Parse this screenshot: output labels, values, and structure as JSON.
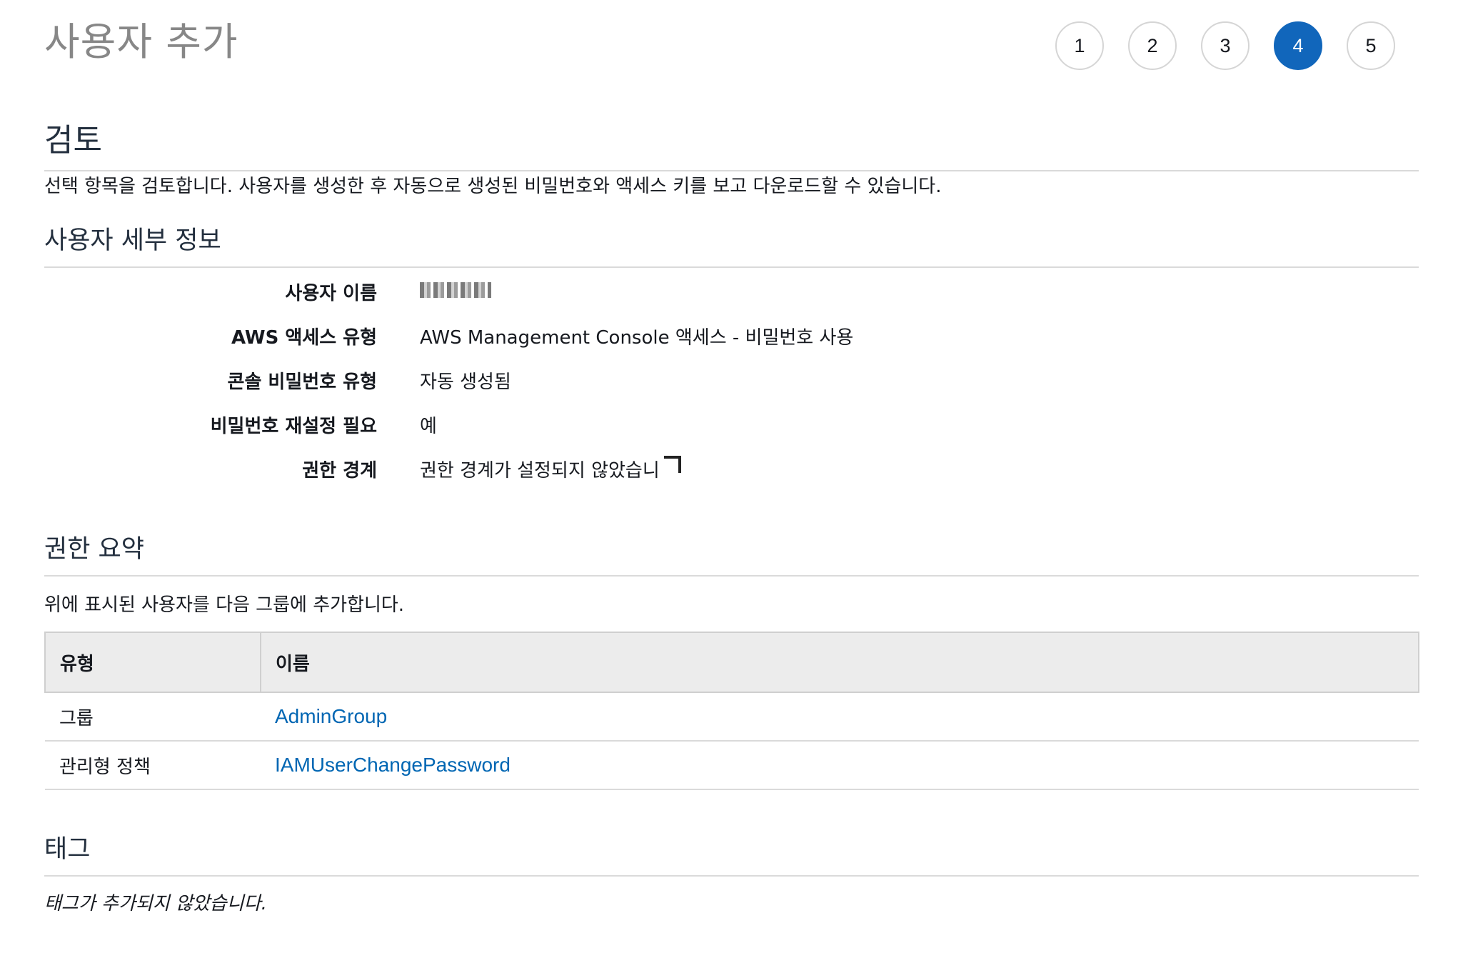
{
  "page": {
    "title": "사용자 추가"
  },
  "steps": [
    "1",
    "2",
    "3",
    "4",
    "5"
  ],
  "active_step": "4",
  "review": {
    "title": "검토",
    "description": "선택 항목을 검토합니다. 사용자를 생성한 후 자동으로 생성된 비밀번호와 액세스 키를 보고 다운로드할 수 있습니다."
  },
  "user_details": {
    "title": "사용자 세부 정보",
    "rows": [
      {
        "label": "사용자 이름",
        "value": ""
      },
      {
        "label": "AWS 액세스 유형",
        "value": "AWS Management Console 액세스 - 비밀번호 사용"
      },
      {
        "label": "콘솔 비밀번호 유형",
        "value": "자동 생성됨"
      },
      {
        "label": "비밀번호 재설정 필요",
        "value": "예"
      },
      {
        "label": "권한 경계",
        "value": "권한 경계가 설정되지 않았습니"
      }
    ]
  },
  "permissions": {
    "title": "권한 요약",
    "description": "위에 표시된 사용자를 다음 그룹에 추가합니다.",
    "columns": [
      "유형",
      "이름"
    ],
    "rows": [
      {
        "type": "그룹",
        "name": "AdminGroup"
      },
      {
        "type": "관리형 정책",
        "name": "IAMUserChangePassword"
      }
    ]
  },
  "tags": {
    "title": "태그",
    "empty_note": "태그가 추가되지 않았습니다."
  }
}
